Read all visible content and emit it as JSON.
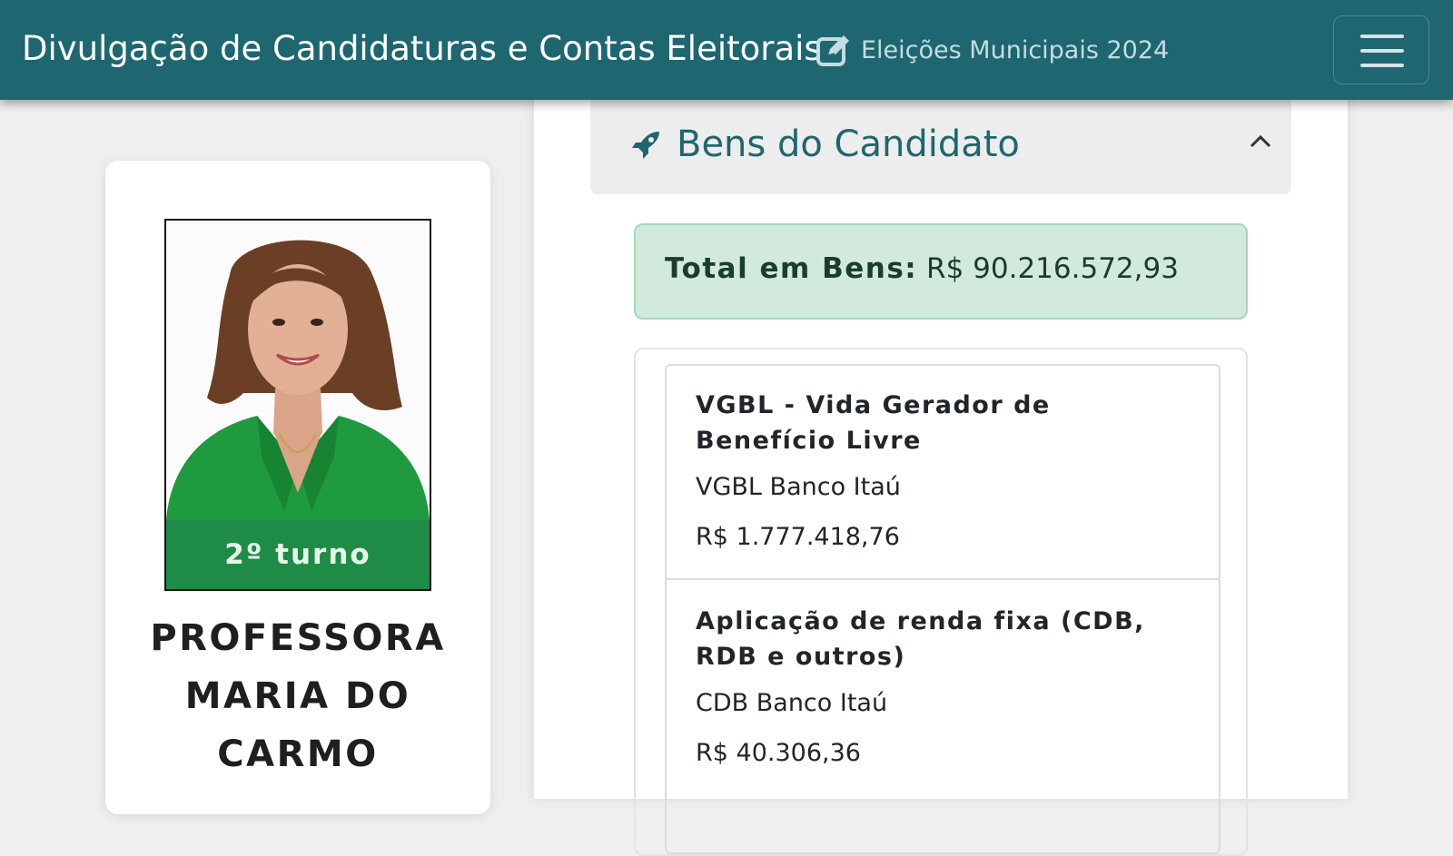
{
  "header": {
    "brand": "Divulgação de Candidaturas e Contas Eleitorais",
    "election_label": "Eleições Municipais 2024",
    "icons": {
      "election": "edit-icon",
      "menu": "hamburger-menu-icon"
    }
  },
  "candidate": {
    "photo_icon": "candidate-photo",
    "badge": "2º turno",
    "name_lines": [
      "PROFESSORA",
      "MARIA DO",
      "CARMO"
    ]
  },
  "assets_section": {
    "title": "Bens do Candidato",
    "icons": {
      "title": "rocket-icon",
      "toggle": "chevron-up-icon"
    },
    "total_label": "Total em Bens:",
    "total_value": "R$ 90.216.572,93",
    "items": [
      {
        "type": "VGBL - Vida Gerador de Benefício Livre",
        "description": "VGBL Banco Itaú",
        "value": "R$ 1.777.418,76"
      },
      {
        "type": "Aplicação de renda fixa (CDB, RDB e outros)",
        "description": "CDB Banco Itaú",
        "value": "R$ 40.306,36"
      }
    ]
  },
  "colors": {
    "header_bg": "#1e6670",
    "badge_bg": "#1e8c46",
    "total_box_bg": "#d2eade",
    "accent_text": "#1e6670"
  }
}
